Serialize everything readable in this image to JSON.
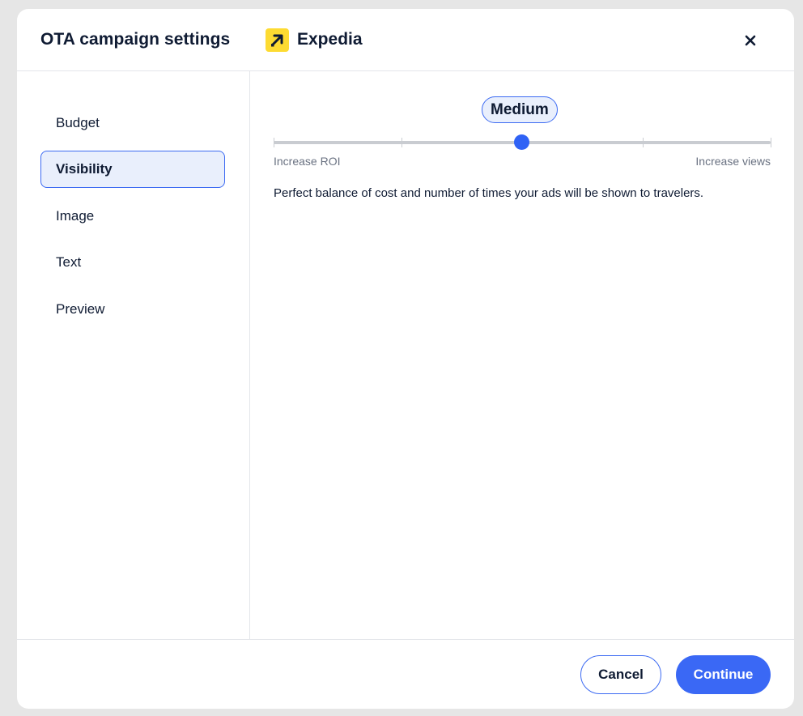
{
  "header": {
    "title": "OTA campaign settings",
    "brand_name": "Expedia",
    "brand_logo_icon": "expedia-arrow-icon",
    "brand_color": "#fddb32",
    "close_icon": "close-icon"
  },
  "sidebar": {
    "items": [
      {
        "label": "Budget",
        "active": false
      },
      {
        "label": "Visibility",
        "active": true
      },
      {
        "label": "Image",
        "active": false
      },
      {
        "label": "Text",
        "active": false
      },
      {
        "label": "Preview",
        "active": false
      }
    ]
  },
  "visibility": {
    "selected_level": "Medium",
    "slider_value": 2,
    "slider_steps": 5,
    "min_label": "Increase ROI",
    "max_label": "Increase views",
    "description": "Perfect balance of cost and number of times your ads will be shown to travelers."
  },
  "footer": {
    "cancel_label": "Cancel",
    "continue_label": "Continue"
  },
  "colors": {
    "accent": "#3a68f5",
    "accent_light": "#e9effc",
    "text": "#0f1b33"
  }
}
